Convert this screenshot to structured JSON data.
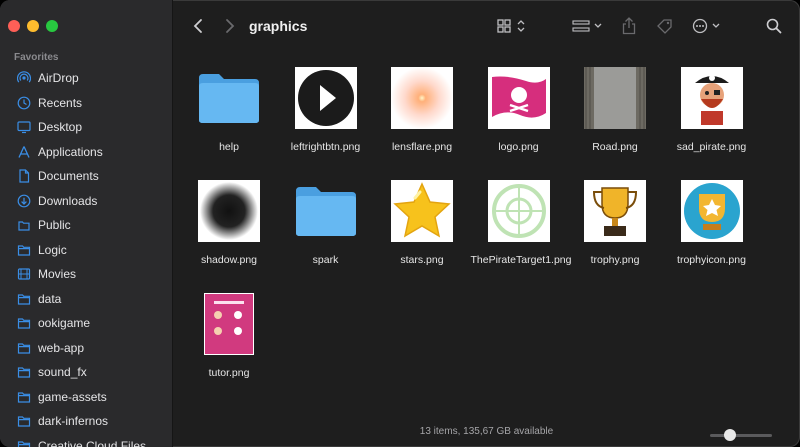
{
  "window": {
    "title": "graphics"
  },
  "sidebar": {
    "section": "Favorites",
    "items": [
      {
        "label": "AirDrop",
        "icon": "airdrop-icon"
      },
      {
        "label": "Recents",
        "icon": "clock-icon"
      },
      {
        "label": "Desktop",
        "icon": "desktop-icon"
      },
      {
        "label": "Applications",
        "icon": "applications-icon"
      },
      {
        "label": "Documents",
        "icon": "document-icon"
      },
      {
        "label": "Downloads",
        "icon": "download-icon"
      },
      {
        "label": "Public",
        "icon": "public-icon"
      },
      {
        "label": "Logic",
        "icon": "folder-icon"
      },
      {
        "label": "Movies",
        "icon": "movies-icon"
      },
      {
        "label": "data",
        "icon": "folder-icon"
      },
      {
        "label": "ookigame",
        "icon": "folder-icon"
      },
      {
        "label": "web-app",
        "icon": "folder-icon"
      },
      {
        "label": "sound_fx",
        "icon": "folder-icon"
      },
      {
        "label": "game-assets",
        "icon": "folder-icon"
      },
      {
        "label": "dark-infernos",
        "icon": "folder-icon"
      },
      {
        "label": "Creative Cloud Files",
        "icon": "folder-icon"
      }
    ]
  },
  "files": [
    {
      "name": "help",
      "kind": "folder"
    },
    {
      "name": "leftrightbtn.png",
      "kind": "play"
    },
    {
      "name": "lensflare.png",
      "kind": "flare"
    },
    {
      "name": "logo.png",
      "kind": "logo"
    },
    {
      "name": "Road.png",
      "kind": "road"
    },
    {
      "name": "sad_pirate.png",
      "kind": "pirate"
    },
    {
      "name": "shadow.png",
      "kind": "shadow"
    },
    {
      "name": "spark",
      "kind": "folder"
    },
    {
      "name": "stars.png",
      "kind": "star"
    },
    {
      "name": "ThePirateTarget1.png",
      "kind": "target"
    },
    {
      "name": "trophy.png",
      "kind": "trophy"
    },
    {
      "name": "trophyicon.png",
      "kind": "trophyicon"
    },
    {
      "name": "tutor.png",
      "kind": "tutor"
    }
  ],
  "status": {
    "text": "13 items, 135,67 GB available"
  },
  "colors": {
    "accent": "#3a8ee6",
    "folder": "#5fb4f0",
    "sidebar_bg": "#2a2a2c",
    "content_bg": "#1e1e1e"
  }
}
